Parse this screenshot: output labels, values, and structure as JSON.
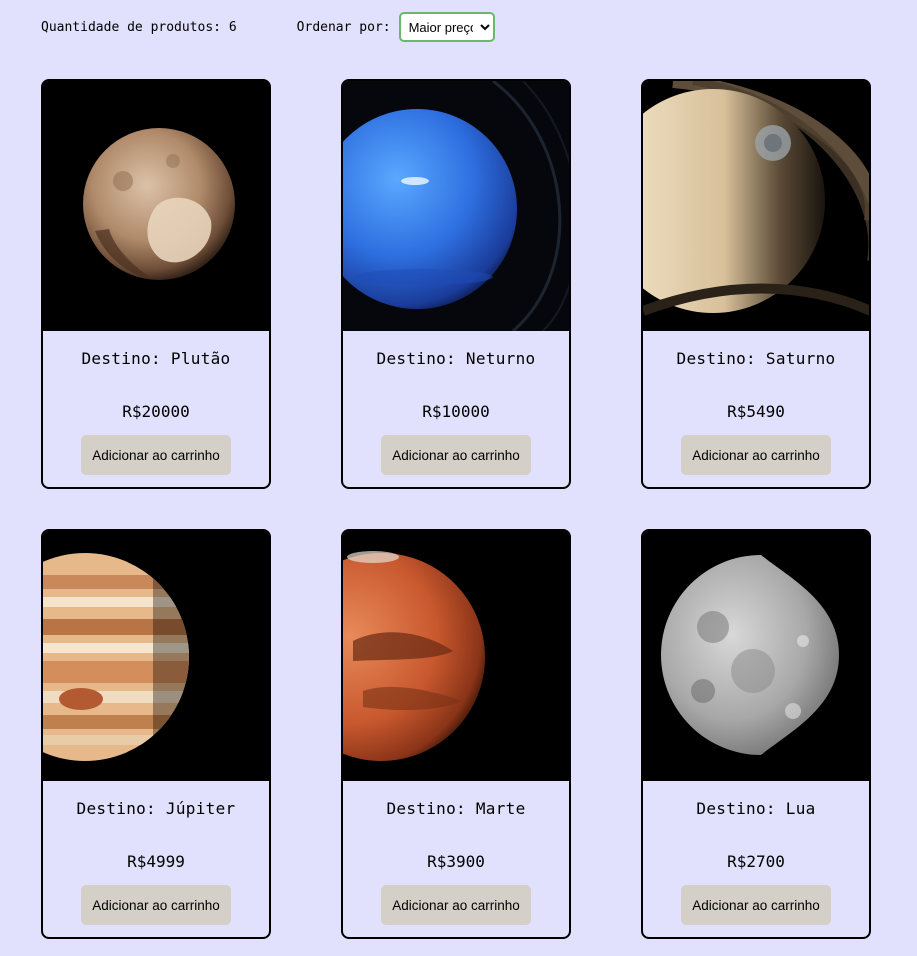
{
  "header": {
    "count_label": "Quantidade de produtos: ",
    "count_value": "6",
    "sort_label": "Ordenar por:",
    "sort_selected": "Maior preço"
  },
  "products": [
    {
      "title": "Destino: Plutão",
      "price": "R$20000",
      "button": "Adicionar ao carrinho",
      "image": "pluto-image"
    },
    {
      "title": "Destino: Neturno",
      "price": "R$10000",
      "button": "Adicionar ao carrinho",
      "image": "neptune-image"
    },
    {
      "title": "Destino: Saturno",
      "price": "R$5490",
      "button": "Adicionar ao carrinho",
      "image": "saturn-image"
    },
    {
      "title": "Destino: Júpiter",
      "price": "R$4999",
      "button": "Adicionar ao carrinho",
      "image": "jupiter-image"
    },
    {
      "title": "Destino: Marte",
      "price": "R$3900",
      "button": "Adicionar ao carrinho",
      "image": "mars-image"
    },
    {
      "title": "Destino: Lua",
      "price": "R$2700",
      "button": "Adicionar ao carrinho",
      "image": "moon-image"
    }
  ]
}
